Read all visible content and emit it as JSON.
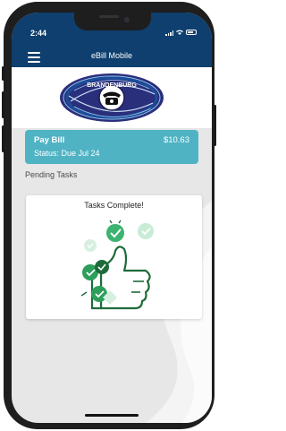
{
  "status_bar": {
    "time": "2:44"
  },
  "app_bar": {
    "title": "eBill Mobile",
    "menu_icon": "hamburger-menu-icon"
  },
  "logo": {
    "text": "BRANDENBURG",
    "icon": "telephone-icon"
  },
  "pay_bill": {
    "title": "Pay Bill",
    "amount": "$10.63",
    "status": "Status: Due Jul 24"
  },
  "pending_tasks": {
    "heading": "Pending Tasks"
  },
  "task_card": {
    "title": "Tasks Complete!",
    "illustration": "thumbs-up-checkmarks-icon"
  },
  "colors": {
    "header": "#0e3f6e",
    "pay_bill_bg": "#4fb3c4",
    "check_green": "#2e9e5b",
    "light_green": "#6fcf97",
    "page_bg": "#e7e7e7"
  }
}
